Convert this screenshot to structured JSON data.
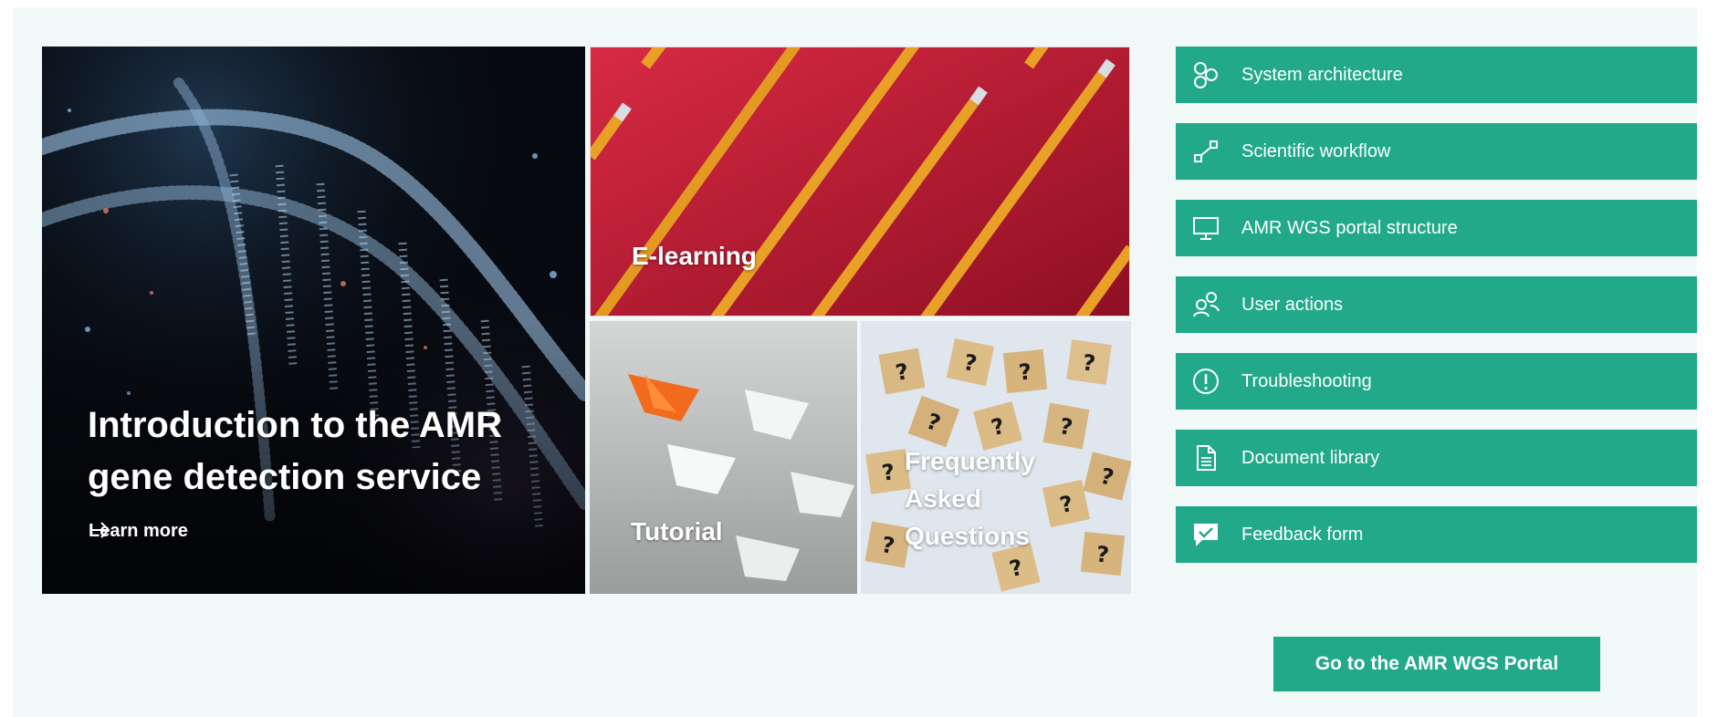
{
  "hero": {
    "title": "Introduction to the AMR gene detection service",
    "link_label": "Learn more"
  },
  "tiles": {
    "elearning": "E-learning",
    "tutorial": "Tutorial",
    "faq": "Frequently Asked Questions"
  },
  "quick_links": [
    {
      "label": "System architecture",
      "icon": "system-architecture-icon"
    },
    {
      "label": "Scientific workflow",
      "icon": "workflow-icon"
    },
    {
      "label": "AMR WGS portal structure",
      "icon": "monitor-icon"
    },
    {
      "label": "User actions",
      "icon": "users-icon"
    },
    {
      "label": "Troubleshooting",
      "icon": "alert-circle-icon"
    },
    {
      "label": "Document library",
      "icon": "document-icon"
    },
    {
      "label": "Feedback form",
      "icon": "feedback-icon"
    }
  ],
  "portal_button": "Go to the AMR WGS Portal",
  "colors": {
    "accent": "#21a989",
    "background": "#f0f8f8",
    "elearning_red": "#c21a33"
  }
}
